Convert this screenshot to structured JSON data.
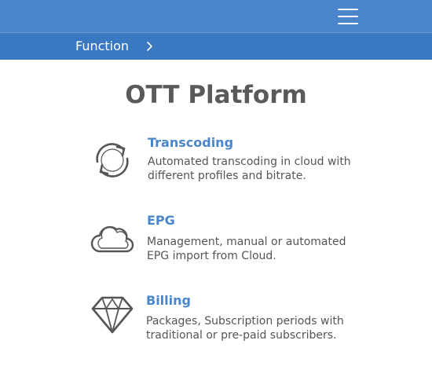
{
  "header": {
    "menu_icon": "hamburger-menu-icon",
    "background_color": "#4a86cb"
  },
  "breadcrumb": {
    "label": "Function",
    "icon": "chevron-right-icon",
    "background_color": "#3a78c1"
  },
  "main": {
    "title": "OTT Platform",
    "features": [
      {
        "icon": "sync-arrows-icon",
        "title": "Transcoding",
        "description": "Automated transcoding in cloud with different profiles and bitrate."
      },
      {
        "icon": "cloud-icon",
        "title": "EPG",
        "description": "Management, manual or automated EPG import from Cloud."
      },
      {
        "icon": "diamond-icon",
        "title": "Billing",
        "description": "Packages, Subscription periods with traditional or pre-paid subscribers."
      }
    ]
  },
  "colors": {
    "accent": "#4a86cb",
    "title_text": "#5a5a5a",
    "body_text": "#555555",
    "icon_stroke": "#555555"
  }
}
